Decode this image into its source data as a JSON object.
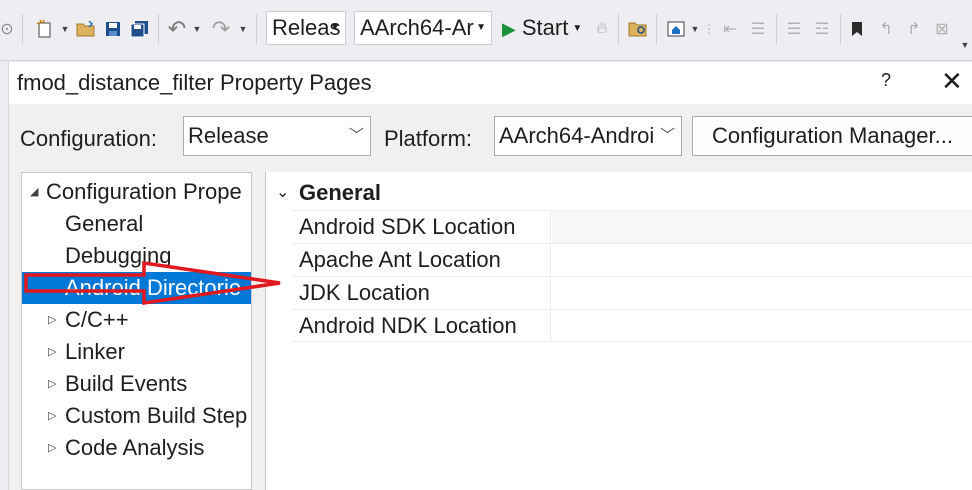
{
  "toolbar": {
    "config_value": "Releas",
    "platform_value": "AArch64-Ar",
    "start_label": "Start"
  },
  "dialog": {
    "title": "fmod_distance_filter Property Pages",
    "help_label": "?",
    "close_label": "✕",
    "configuration_label": "Configuration:",
    "configuration_value": "Release",
    "platform_label": "Platform:",
    "platform_value": "AArch64-Androi",
    "configuration_manager_label": "Configuration Manager..."
  },
  "tree": {
    "items": [
      {
        "label": "Configuration Prope",
        "expander": "◢"
      },
      {
        "label": "General",
        "expander": ""
      },
      {
        "label": "Debugging",
        "expander": ""
      },
      {
        "label": "Android Directorie",
        "expander": "",
        "selected": true
      },
      {
        "label": "C/C++",
        "expander": "▷"
      },
      {
        "label": "Linker",
        "expander": "▷"
      },
      {
        "label": "Build Events",
        "expander": "▷"
      },
      {
        "label": "Custom Build Step",
        "expander": "▷"
      },
      {
        "label": "Code Analysis",
        "expander": "▷"
      }
    ]
  },
  "grid": {
    "category": "General",
    "category_expander": "⌄",
    "properties": [
      {
        "name": "Android SDK Location",
        "value": ""
      },
      {
        "name": "Apache Ant Location",
        "value": ""
      },
      {
        "name": "JDK Location",
        "value": ""
      },
      {
        "name": "Android NDK Location",
        "value": ""
      }
    ]
  },
  "annotation": {
    "arrow_color": "#e0191f"
  }
}
